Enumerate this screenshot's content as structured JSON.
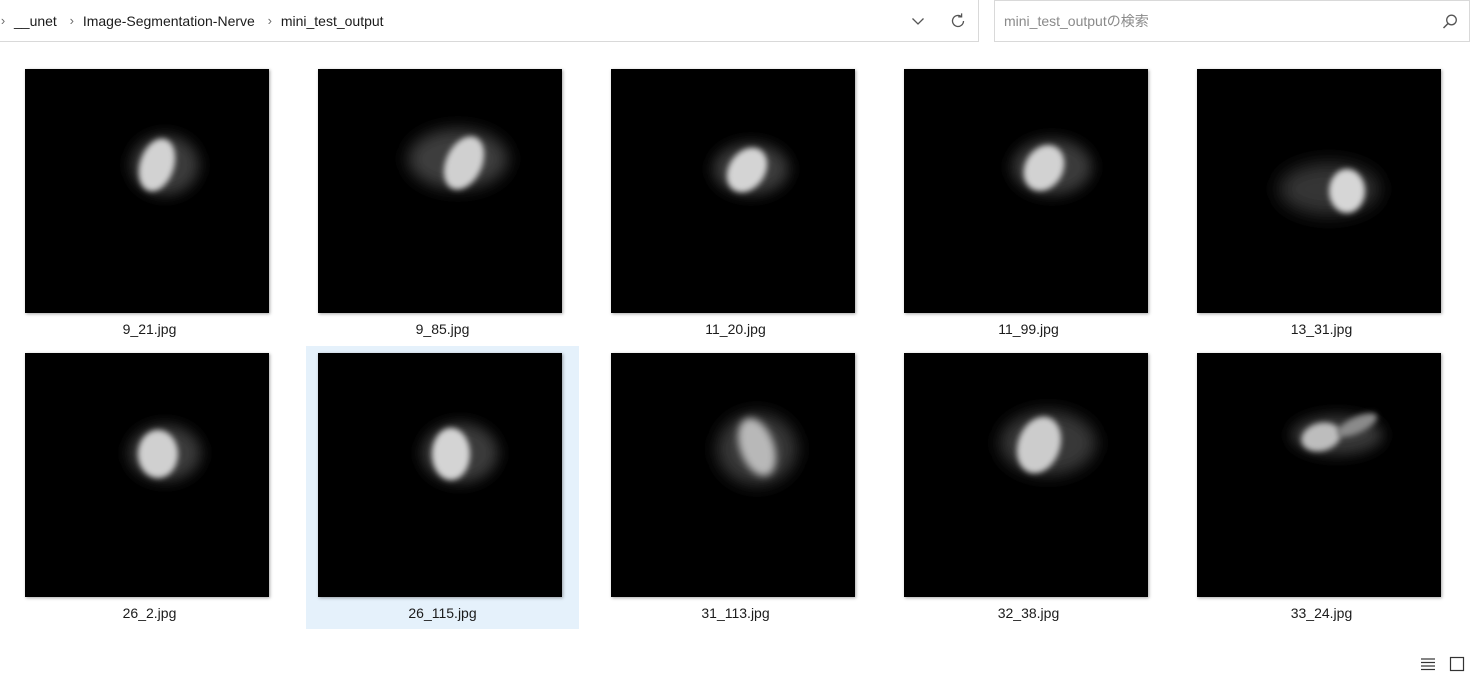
{
  "breadcrumb": {
    "items": [
      "__unet",
      "Image-Segmentation-Nerve",
      "mini_test_output"
    ]
  },
  "search": {
    "placeholder": "mini_test_outputの検索",
    "value": ""
  },
  "icons": {
    "breadcrumb_separator": "chevron-right-icon",
    "address_dropdown": "chevron-down-icon",
    "refresh": "refresh-icon",
    "search": "search-icon",
    "details_view": "details-view-icon",
    "large_icons_view": "large-icons-view-icon"
  },
  "colors": {
    "selection": "#e5f1fb",
    "thumbnail_background": "#000000"
  },
  "files": [
    {
      "name": "9_21.jpg",
      "selected": false
    },
    {
      "name": "9_85.jpg",
      "selected": false
    },
    {
      "name": "11_20.jpg",
      "selected": false
    },
    {
      "name": "11_99.jpg",
      "selected": false
    },
    {
      "name": "13_31.jpg",
      "selected": false
    },
    {
      "name": "26_2.jpg",
      "selected": false
    },
    {
      "name": "26_115.jpg",
      "selected": true
    },
    {
      "name": "31_113.jpg",
      "selected": false
    },
    {
      "name": "32_38.jpg",
      "selected": false
    },
    {
      "name": "33_24.jpg",
      "selected": false
    }
  ]
}
